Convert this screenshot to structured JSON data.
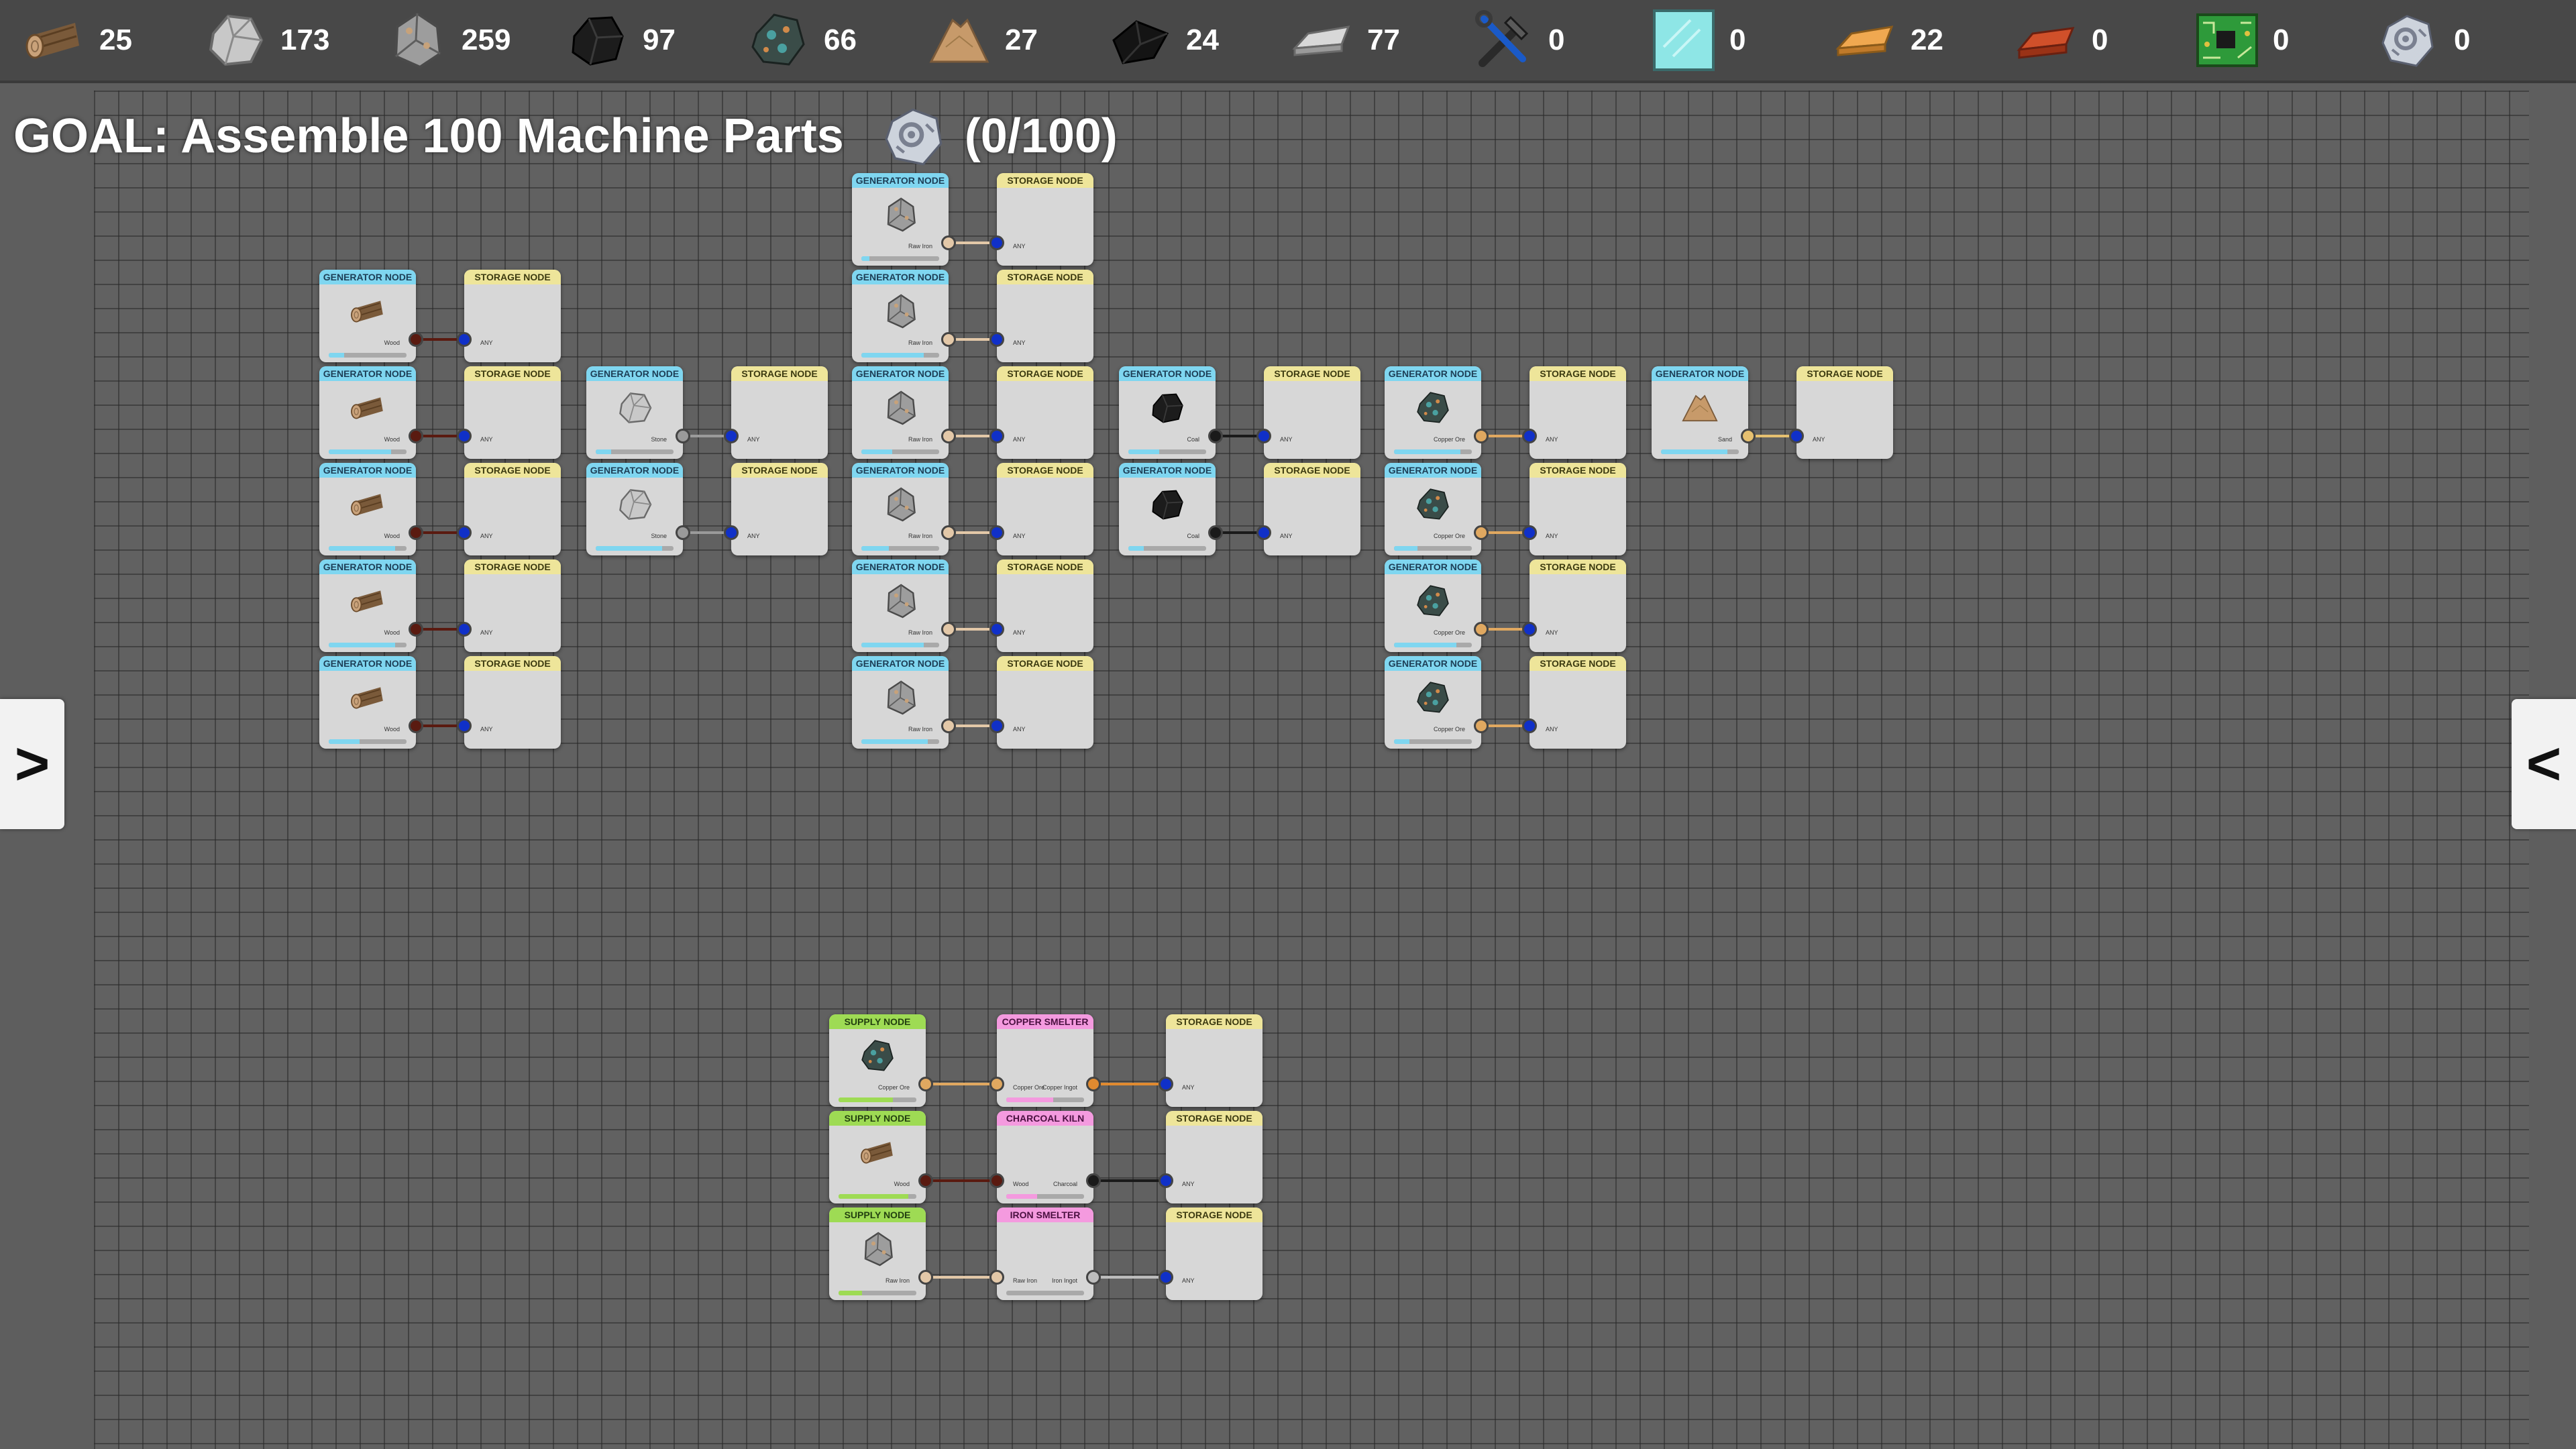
{
  "resources": [
    {
      "name": "wood",
      "icon": "wood-log-icon",
      "count": "25"
    },
    {
      "name": "stone",
      "icon": "stone-icon",
      "count": "173"
    },
    {
      "name": "raw-iron",
      "icon": "raw-iron-icon",
      "count": "259"
    },
    {
      "name": "coal",
      "icon": "coal-icon",
      "count": "97"
    },
    {
      "name": "copper-ore",
      "icon": "copper-ore-icon",
      "count": "66"
    },
    {
      "name": "sand",
      "icon": "sand-pile-icon",
      "count": "27"
    },
    {
      "name": "charcoal",
      "icon": "charcoal-icon",
      "count": "24"
    },
    {
      "name": "iron-ingot",
      "icon": "iron-ingot-icon",
      "count": "77"
    },
    {
      "name": "tools",
      "icon": "tools-icon",
      "count": "0"
    },
    {
      "name": "glass",
      "icon": "glass-pane-icon",
      "count": "0"
    },
    {
      "name": "copper-ingot",
      "icon": "copper-ingot-icon",
      "count": "22"
    },
    {
      "name": "brick",
      "icon": "brick-icon",
      "count": "0"
    },
    {
      "name": "circuit-board",
      "icon": "circuit-board-icon",
      "count": "0"
    },
    {
      "name": "machine-parts",
      "icon": "machine-parts-icon",
      "count": "0"
    }
  ],
  "goal": {
    "text": "GOAL: Assemble 100 Machine Parts",
    "icon": "machine-parts-icon",
    "progress": "(0/100)",
    "current": 0,
    "target": 100
  },
  "nav": {
    "left": ">",
    "right": "<"
  },
  "colors": {
    "generator": "#7fd6f0",
    "storage": "#eee59a",
    "supply": "#9edb54",
    "processor": "#f49adf",
    "port_any": "#1030c8",
    "port_wood": "#5a1a10",
    "port_stone": "#9a9a9a",
    "port_raw_iron": "#e3c8a8",
    "port_coal": "#1a1a1a",
    "port_copper": "#e0a860",
    "port_sand": "#e6c070",
    "port_charcoal": "#1a1a1a",
    "port_iron_ingot": "#bdbdbd",
    "port_copper_ingot": "#e08a30"
  },
  "labels": {
    "generator": "GENERATOR NODE",
    "storage": "STORAGE NODE",
    "supply": "SUPPLY NODE",
    "copper_smelter": "COPPER SMELTER",
    "charcoal_kiln": "CHARCOAL KILN",
    "iron_smelter": "IRON SMELTER",
    "any": "ANY"
  },
  "generator_chains": [
    {
      "resource": "Wood",
      "icon": "wood-log-icon",
      "port": "#5a1a10",
      "progress": [
        0.2,
        0.8,
        0.85,
        0.85,
        0.4
      ]
    },
    {
      "resource": "Stone",
      "icon": "stone-icon",
      "port": "#9a9a9a",
      "progress": [
        0.2,
        0.85
      ]
    },
    {
      "resource": "Raw Iron",
      "icon": "raw-iron-icon",
      "port": "#e3c8a8",
      "progress": [
        0.1,
        0.8,
        0.4,
        0.35,
        0.8,
        0.85
      ]
    },
    {
      "resource": "Coal",
      "icon": "coal-icon",
      "port": "#1a1a1a",
      "progress": [
        0.4,
        0.2
      ]
    },
    {
      "resource": "Copper Ore",
      "icon": "copper-ore-icon",
      "port": "#e0a860",
      "progress": [
        0.85,
        0.3,
        0.8,
        0.2
      ]
    },
    {
      "resource": "Sand",
      "icon": "sand-pile-icon",
      "port": "#e6c070",
      "progress": [
        0.85
      ]
    }
  ],
  "production": [
    {
      "supply_label": "Copper Ore",
      "supply_icon": "copper-ore-icon",
      "in_port": "#e0a860",
      "processor": "COPPER SMELTER",
      "processor_in": "Copper Ore",
      "processor_out": "Copper Ingot",
      "out_port": "#e08a30",
      "supply_progress": 0.7,
      "proc_progress": 0.6
    },
    {
      "supply_label": "Wood",
      "supply_icon": "wood-log-icon",
      "in_port": "#5a1a10",
      "processor": "CHARCOAL KILN",
      "processor_in": "Wood",
      "processor_out": "Charcoal",
      "out_port": "#1a1a1a",
      "supply_progress": 0.9,
      "proc_progress": 0.4
    },
    {
      "supply_label": "Raw Iron",
      "supply_icon": "raw-iron-icon",
      "in_port": "#e3c8a8",
      "processor": "IRON SMELTER",
      "processor_in": "Raw Iron",
      "processor_out": "Iron Ingot",
      "out_port": "#bdbdbd",
      "supply_progress": 0.3,
      "proc_progress": 0.0
    }
  ]
}
